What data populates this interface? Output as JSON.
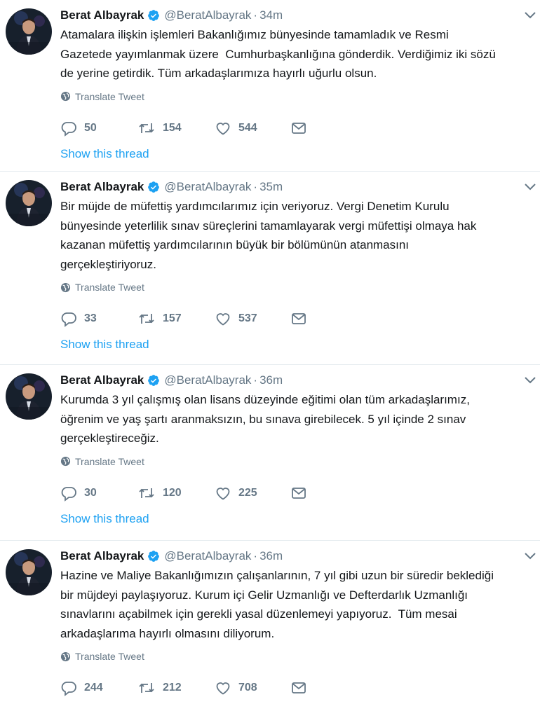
{
  "colors": {
    "accent": "#1da1f2",
    "muted": "#657786",
    "text": "#14171a",
    "divider": "#e6ecf0"
  },
  "tweets": [
    {
      "name": "Berat Albayrak",
      "handle": "@BeratAlbayrak",
      "separator": "·",
      "time": "34m",
      "text": "Atamalara ilişkin işlemleri Bakanlığımız bünyesinde tamamladık ve Resmi\nGazetede yayımlanmak üzere  Cumhurbaşkanlığına gönderdik. Verdiğimiz iki sözü\nde yerine getirdik. Tüm arkadaşlarımıza hayırlı uğurlu olsun.",
      "translate": "Translate Tweet",
      "replies": "50",
      "retweets": "154",
      "likes": "544",
      "thread": "Show this thread"
    },
    {
      "name": "Berat Albayrak",
      "handle": "@BeratAlbayrak",
      "separator": "·",
      "time": "35m",
      "text": "Bir müjde de müfettiş yardımcılarımız için veriyoruz. Vergi Denetim Kurulu\nbünyesinde yeterlilik sınav süreçlerini tamamlayarak vergi müfettişi olmaya hak\nkazanan müfettiş yardımcılarının büyük bir bölümünün atanmasını\ngerçekleştiriyoruz.",
      "translate": "Translate Tweet",
      "replies": "33",
      "retweets": "157",
      "likes": "537",
      "thread": "Show this thread"
    },
    {
      "name": "Berat Albayrak",
      "handle": "@BeratAlbayrak",
      "separator": "·",
      "time": "36m",
      "text": "Kurumda 3 yıl çalışmış olan lisans düzeyinde eğitimi olan tüm arkadaşlarımız,\nöğrenim ve yaş şartı aranmaksızın, bu sınava girebilecek. 5 yıl içinde 2 sınav\ngerçekleştireceğiz.",
      "translate": "Translate Tweet",
      "replies": "30",
      "retweets": "120",
      "likes": "225",
      "thread": "Show this thread"
    },
    {
      "name": "Berat Albayrak",
      "handle": "@BeratAlbayrak",
      "separator": "·",
      "time": "36m",
      "text": "Hazine ve Maliye Bakanlığımızın çalışanlarının, 7 yıl gibi uzun bir süredir beklediği\nbir müjdeyi paylaşıyoruz. Kurum içi Gelir Uzmanlığı ve Defterdarlık Uzmanlığı\nsınavlarını açabilmek için gerekli yasal düzenlemeyi yapıyoruz.  Tüm mesai\narkadaşlarıma hayırlı olmasını diliyorum.",
      "translate": "Translate Tweet",
      "replies": "244",
      "retweets": "212",
      "likes": "708",
      "thread": ""
    }
  ]
}
